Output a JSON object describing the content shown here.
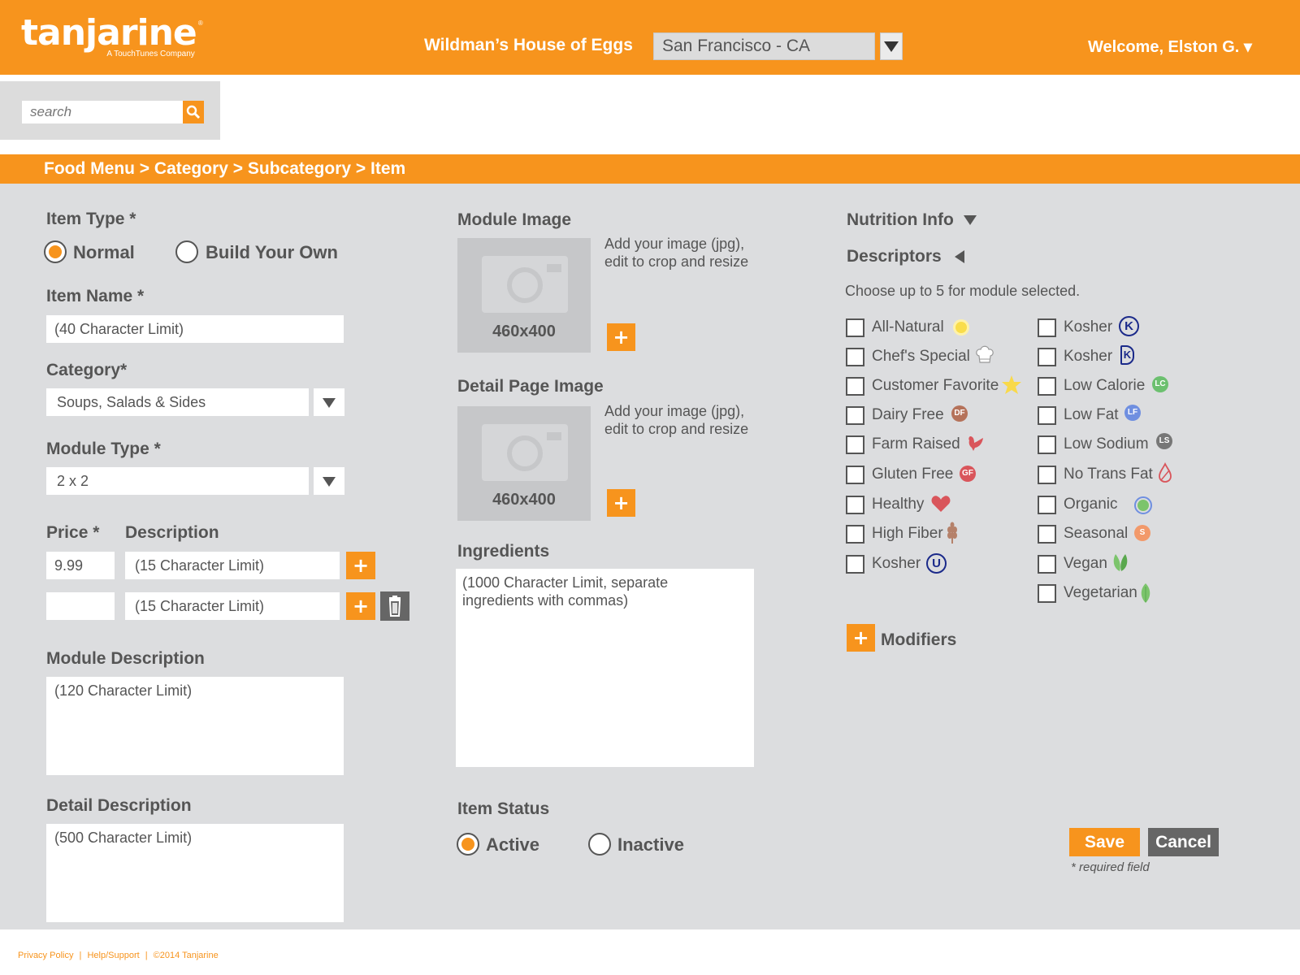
{
  "header": {
    "logo_text": "tanjarine",
    "logo_tagline": "A TouchTunes Company",
    "logo_tm": "®",
    "restaurant": "Wildman’s House of Eggs",
    "location": "San Francisco - CA",
    "welcome": "Welcome, Elston G. ▾"
  },
  "search": {
    "placeholder": "search"
  },
  "breadcrumb": "Food Menu > Category > Subcategory > Item",
  "left": {
    "item_type_label": "Item Type *",
    "item_type_options": [
      "Normal",
      "Build Your Own"
    ],
    "item_type_selected": "Normal",
    "item_name_label": "Item Name *",
    "item_name_placeholder": "(40 Character Limit)",
    "category_label": "Category*",
    "category_value": "Soups, Salads & Sides",
    "module_type_label": "Module Type *",
    "module_type_value": "2 x 2",
    "price_label": "Price *",
    "description_label": "Description",
    "price_rows": [
      {
        "price": "9.99",
        "description_placeholder": "(15 Character Limit)"
      },
      {
        "price": "",
        "description_placeholder": "(15 Character Limit)"
      }
    ],
    "module_description_label": "Module Description",
    "module_description_placeholder": "(120 Character Limit)",
    "detail_description_label": "Detail Description",
    "detail_description_placeholder": "(500 Character Limit)"
  },
  "middle": {
    "module_image_label": "Module Image",
    "detail_image_label": "Detail Page Image",
    "image_size": "460x400",
    "image_hint_line1": "Add your image (jpg),",
    "image_hint_line2": "edit to crop and resize",
    "ingredients_label": "Ingredients",
    "ingredients_placeholder_line1": "(1000 Character Limit, separate",
    "ingredients_placeholder_line2": "ingredients with commas)",
    "item_status_label": "Item Status",
    "status_options": [
      "Active",
      "Inactive"
    ],
    "status_selected": "Active"
  },
  "right": {
    "nutrition_label": "Nutrition Info",
    "descriptors_label": "Descriptors",
    "descriptors_hint": "Choose up to 5 for module selected.",
    "descriptors_col1": [
      {
        "label": "All-Natural",
        "icon": "sun-icon"
      },
      {
        "label": "Chef's Special",
        "icon": "chef-hat-icon"
      },
      {
        "label": "Customer Favorite",
        "icon": "star-icon"
      },
      {
        "label": "Dairy Free",
        "icon": "dairy-free-icon",
        "badge": "DF"
      },
      {
        "label": "Farm Raised",
        "icon": "rooster-icon"
      },
      {
        "label": "Gluten Free",
        "icon": "gluten-free-icon",
        "badge": "GF"
      },
      {
        "label": "Healthy",
        "icon": "heart-icon"
      },
      {
        "label": "High Fiber",
        "icon": "wheat-icon"
      },
      {
        "label": "Kosher",
        "icon": "kosher-u-icon",
        "badge": "U"
      }
    ],
    "descriptors_col2": [
      {
        "label": "Kosher",
        "icon": "kosher-k-icon",
        "badge": "K"
      },
      {
        "label": "Kosher",
        "icon": "kosher-kd-icon",
        "badge": "K"
      },
      {
        "label": "Low Calorie",
        "icon": "low-calorie-icon",
        "badge": "LC"
      },
      {
        "label": "Low Fat",
        "icon": "low-fat-icon",
        "badge": "LF"
      },
      {
        "label": "Low Sodium",
        "icon": "low-sodium-icon",
        "badge": "LS"
      },
      {
        "label": "No Trans Fat",
        "icon": "drop-icon"
      },
      {
        "label": "Organic",
        "icon": "organic-icon"
      },
      {
        "label": "Seasonal",
        "icon": "seasonal-icon",
        "badge": "S"
      },
      {
        "label": "Vegan",
        "icon": "leaves-icon"
      },
      {
        "label": "Vegetarian",
        "icon": "leaf-icon"
      }
    ],
    "modifiers_label": "Modifiers",
    "save_label": "Save",
    "cancel_label": "Cancel",
    "required_note": "* required field"
  },
  "footer": {
    "links": [
      "Privacy Policy",
      "|",
      "Help/Support",
      "|",
      "©2014 Tanjarine"
    ]
  },
  "colors": {
    "accent": "#f7941d",
    "panel": "#dcdddf",
    "text": "#555555"
  }
}
